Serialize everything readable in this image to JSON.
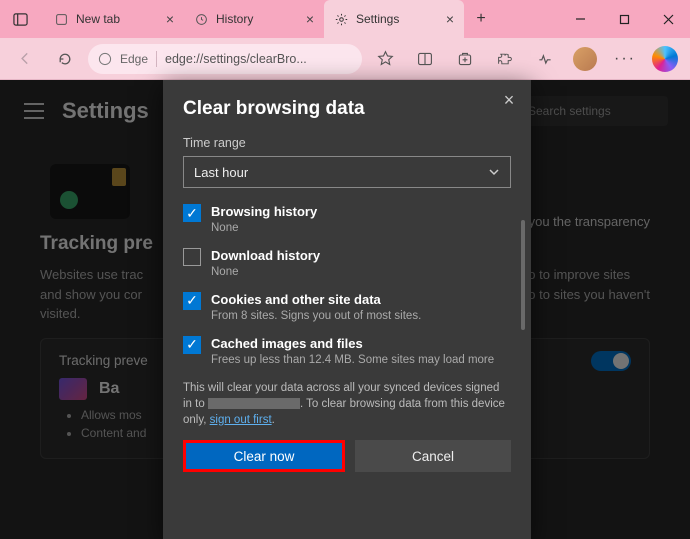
{
  "tabs": [
    {
      "label": "New tab"
    },
    {
      "label": "History"
    },
    {
      "label": "Settings"
    }
  ],
  "address": {
    "engine": "Edge",
    "url": "edge://settings/clearBro..."
  },
  "settings": {
    "title": "Settings",
    "search_placeholder": "Search settings",
    "transparency_tail": "g you the transparency",
    "section_heading": "Tracking pre",
    "section_body_1": "Websites use trac",
    "section_body_2": "and show you cor",
    "section_body_3": "visited.",
    "right_body_1": "fo to improve sites",
    "right_body_2": "fo to sites you haven't",
    "card_title": "Tracking preve",
    "card_label": "Ba",
    "card_list": [
      "Allows mos",
      "Content and"
    ]
  },
  "dialog": {
    "title": "Clear browsing data",
    "time_range_label": "Time range",
    "time_range_value": "Last hour",
    "items": [
      {
        "title": "Browsing history",
        "sub": "None",
        "checked": true
      },
      {
        "title": "Download history",
        "sub": "None",
        "checked": false
      },
      {
        "title": "Cookies and other site data",
        "sub": "From 8 sites. Signs you out of most sites.",
        "checked": true
      },
      {
        "title": "Cached images and files",
        "sub": "Frees up less than 12.4 MB. Some sites may load more",
        "checked": true
      }
    ],
    "notice_1": "This will clear your data across all your synced devices signed in to ",
    "notice_2": ". To clear browsing data from this device only, ",
    "signout_link": "sign out first",
    "notice_period": ".",
    "clear_btn": "Clear now",
    "cancel_btn": "Cancel"
  }
}
